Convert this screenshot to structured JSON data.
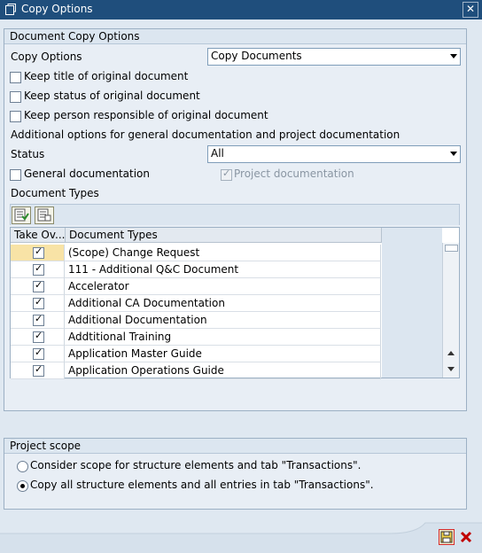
{
  "window": {
    "title": "Copy Options",
    "close_glyph": "✕"
  },
  "doc_group": {
    "title": "Document Copy Options",
    "copy_options": {
      "label": "Copy Options",
      "value": "Copy Documents"
    },
    "checkboxes": [
      {
        "label": "Keep title of original document",
        "checked": false
      },
      {
        "label": "Keep status of original document",
        "checked": false
      },
      {
        "label": "Keep person responsible of original document",
        "checked": false
      }
    ],
    "additional_label": "Additional options for general documentation and project documentation",
    "status": {
      "label": "Status",
      "value": "All"
    },
    "general_doc": {
      "label": "General documentation",
      "checked": false
    },
    "project_doc": {
      "label": "Project documentation",
      "checked": true,
      "disabled": true
    },
    "doc_types_label": "Document Types",
    "toolbar": {
      "select_all_icon": "select-all-icon",
      "deselect_all_icon": "deselect-all-icon"
    },
    "table": {
      "columns": [
        "Take Ov...",
        "Document Types"
      ],
      "rows": [
        {
          "checked": true,
          "name": "(Scope) Change Request"
        },
        {
          "checked": true,
          "name": "111 - Additional Q&C Document"
        },
        {
          "checked": true,
          "name": "Accelerator"
        },
        {
          "checked": true,
          "name": "Additional CA Documentation"
        },
        {
          "checked": true,
          "name": "Additional Documentation"
        },
        {
          "checked": true,
          "name": "Addtitional Training"
        },
        {
          "checked": true,
          "name": "Application Master Guide"
        },
        {
          "checked": true,
          "name": "Application Operations Guide"
        }
      ]
    }
  },
  "scope_group": {
    "title": "Project scope",
    "options": [
      {
        "label": "Consider scope for structure elements and tab \"Transactions\".",
        "selected": false
      },
      {
        "label": "Copy all structure elements and all entries in tab \"Transactions\".",
        "selected": true
      }
    ]
  },
  "footer": {
    "ok_icon": "save-icon",
    "cancel_icon": "cancel-icon",
    "cancel_color": "#c00000"
  }
}
